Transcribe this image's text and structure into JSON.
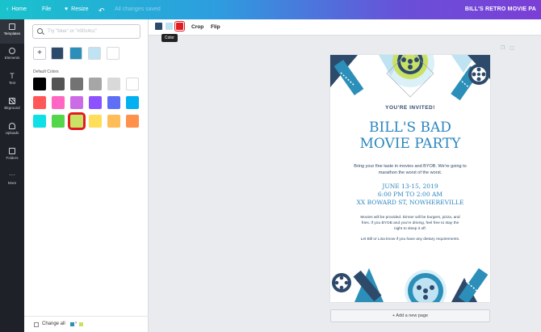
{
  "topbar": {
    "home": "Home",
    "file": "File",
    "resize": "Resize",
    "changes_status": "All changes saved",
    "title": "BILL'S RETRO MOVIE PA"
  },
  "sidenav": [
    {
      "label": "Templates",
      "icon": "templates-icon"
    },
    {
      "label": "Elements",
      "icon": "elements-icon"
    },
    {
      "label": "Text",
      "icon": "text-icon"
    },
    {
      "label": "Bkground",
      "icon": "background-icon"
    },
    {
      "label": "Uploads",
      "icon": "upload-icon"
    },
    {
      "label": "Folders",
      "icon": "folder-icon"
    },
    {
      "label": "More",
      "icon": "more-icon"
    }
  ],
  "panel": {
    "search_placeholder": "Try \"blue\" or \"#00c4cc\"",
    "document_colors": [
      "#2e4a6b",
      "#2b8fb9",
      "#bfe3f2",
      "#ffffff"
    ],
    "default_label": "Default Colors",
    "default_colors": [
      "#000000",
      "#545454",
      "#737373",
      "#a6a6a6",
      "#d9d9d9",
      "#ffffff",
      "#ff5757",
      "#ff66c4",
      "#cb6ce6",
      "#8c52ff",
      "#5e6ff5",
      "#00b0f0",
      "#0ee0e6",
      "#55d64a",
      "#c9e265",
      "#ffde59",
      "#ffbd59",
      "#ff914d"
    ],
    "selected_index": 14,
    "footer_label": "Change all",
    "footer_from": "#2b8fb9",
    "footer_to": "#c9e265"
  },
  "toolbar": {
    "swatches": [
      "#2e4a6b",
      "#bfe3f2",
      "#e21b23"
    ],
    "crop": "Crop",
    "flip": "Flip",
    "tooltip": "Color"
  },
  "flyer": {
    "invited": "YOU'RE INVITED!",
    "headline_1": "BILL'S BAD",
    "headline_2": "MOVIE PARTY",
    "body_1": "Bring your fine taste in movies and BYOB. We're going to marathon the worst of the worst.",
    "date_1": "JUNE 13-15, 2019",
    "date_2": "6:00 PM TO 2:00 AM",
    "date_3": "XX BOWARD ST, NOWHEREVILLE",
    "body_2": "Movies will be provided. Dinner will be burgers, pizza, and fries. If you BYOB and you're driving, feel free to stay the night to sleep it off.",
    "body_3": "Let Bill or Lisa know if you have any dietary requirements.",
    "colors": {
      "navy": "#2e4a6b",
      "blue": "#2b8fb9",
      "light": "#bfe3f2",
      "lime": "#c9e265"
    }
  },
  "add_page": "+ Add a new page"
}
